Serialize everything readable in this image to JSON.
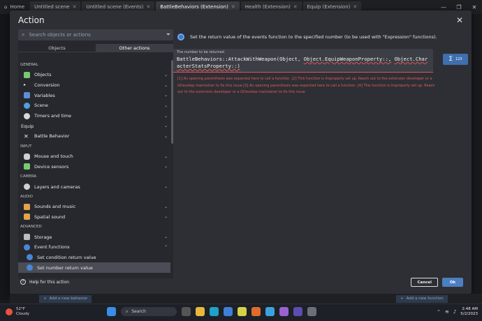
{
  "tabs": [
    {
      "label": "Home"
    },
    {
      "label": "Untitled scene"
    },
    {
      "label": "Untitled scene (Events)"
    },
    {
      "label": "BattleBehaviors (Extension)"
    },
    {
      "label": "Health (Extension)"
    },
    {
      "label": "Equip (Extension)"
    }
  ],
  "dialog": {
    "title": "Action",
    "search_placeholder": "Search objects or actions",
    "mode_tabs": [
      "Objects",
      "Other actions"
    ],
    "sections": {
      "general": "GENERAL",
      "input": "INPUT",
      "camera": "CAMERA",
      "audio": "AUDIO",
      "advanced": "ADVANCED"
    },
    "items": {
      "objects": "Objects",
      "conversion": "Conversion",
      "variables": "Variables",
      "scene": "Scene",
      "timers": "Timers and time",
      "equip": "Equip",
      "battle_behavior": "Battle Behavior",
      "mouse_touch": "Mouse and touch",
      "device_sensors": "Device sensors",
      "layers_cameras": "Layers and cameras",
      "sounds_music": "Sounds and music",
      "spatial_sound": "Spatial sound",
      "storage": "Storage",
      "event_functions": "Event functions",
      "set_condition_return": "Set condition return value",
      "set_number_return": "Set number return value"
    },
    "help": "Help for this action",
    "description": "Set the return value of the events function to the specified number (to be used with \"Expression\" functions).",
    "field_label": "The number to be returned",
    "expr_part1": "BattleBehaviors::AttackWithWeapon(Object, ",
    "expr_part2": "Object.EquipWeaponProperty::,",
    "expr_part3": "Object.CharacterStatsProperty::)",
    "expr_button": "123",
    "errors": "[1] An opening parenthesis was expected here to call a function. [2] This function is improperly set up. Reach out to the extension developer or a GDevelop maintainer to fix this issue [3] An opening parenthesis was expected here to call a function. [4] This function is improperly set up. Reach out to the extension developer or a GDevelop maintainer to fix this issue",
    "cancel": "Cancel",
    "ok": "Ok"
  },
  "behaviors": {
    "add_left": "Add a new behavior",
    "add_right": "Add a new function"
  },
  "taskbar": {
    "temp": "52°F",
    "weather": "Cloudy",
    "search": "Search",
    "time": "2:48 AM",
    "date": "5/2/2023"
  },
  "colors": {
    "accent": "#4c7fc1",
    "error": "#e05a5a"
  }
}
